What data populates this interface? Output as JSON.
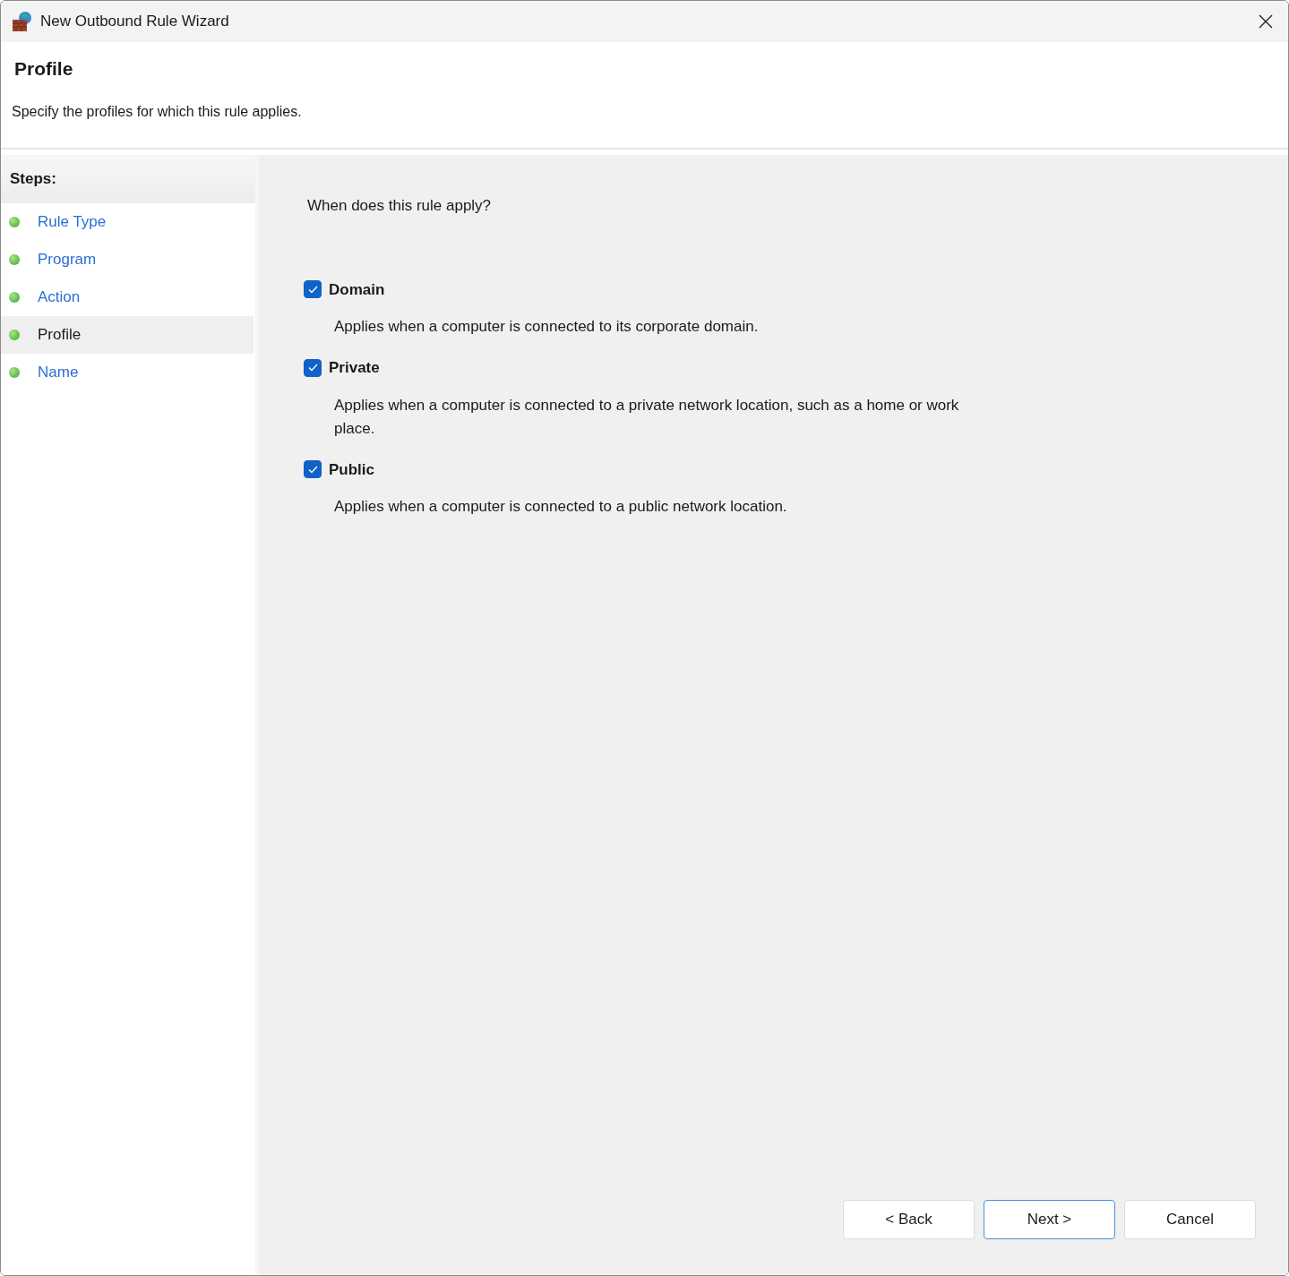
{
  "window": {
    "title": "New Outbound Rule Wizard"
  },
  "header": {
    "title": "Profile",
    "description": "Specify the profiles for which this rule applies."
  },
  "steps": {
    "heading": "Steps:",
    "items": [
      {
        "label": "Rule Type",
        "selected": false
      },
      {
        "label": "Program",
        "selected": false
      },
      {
        "label": "Action",
        "selected": false
      },
      {
        "label": "Profile",
        "selected": true
      },
      {
        "label": "Name",
        "selected": false
      }
    ]
  },
  "question": "When does this rule apply?",
  "profiles": [
    {
      "label": "Domain",
      "checked": true,
      "description": "Applies when a computer is connected to its corporate domain."
    },
    {
      "label": "Private",
      "checked": true,
      "description": "Applies when a computer is connected to a private network location, such as a home or work place."
    },
    {
      "label": "Public",
      "checked": true,
      "description": "Applies when a computer is connected to a public network location."
    }
  ],
  "buttons": [
    {
      "label": "< Back",
      "default": false
    },
    {
      "label": "Next >",
      "default": true
    },
    {
      "label": "Cancel",
      "default": false
    }
  ]
}
